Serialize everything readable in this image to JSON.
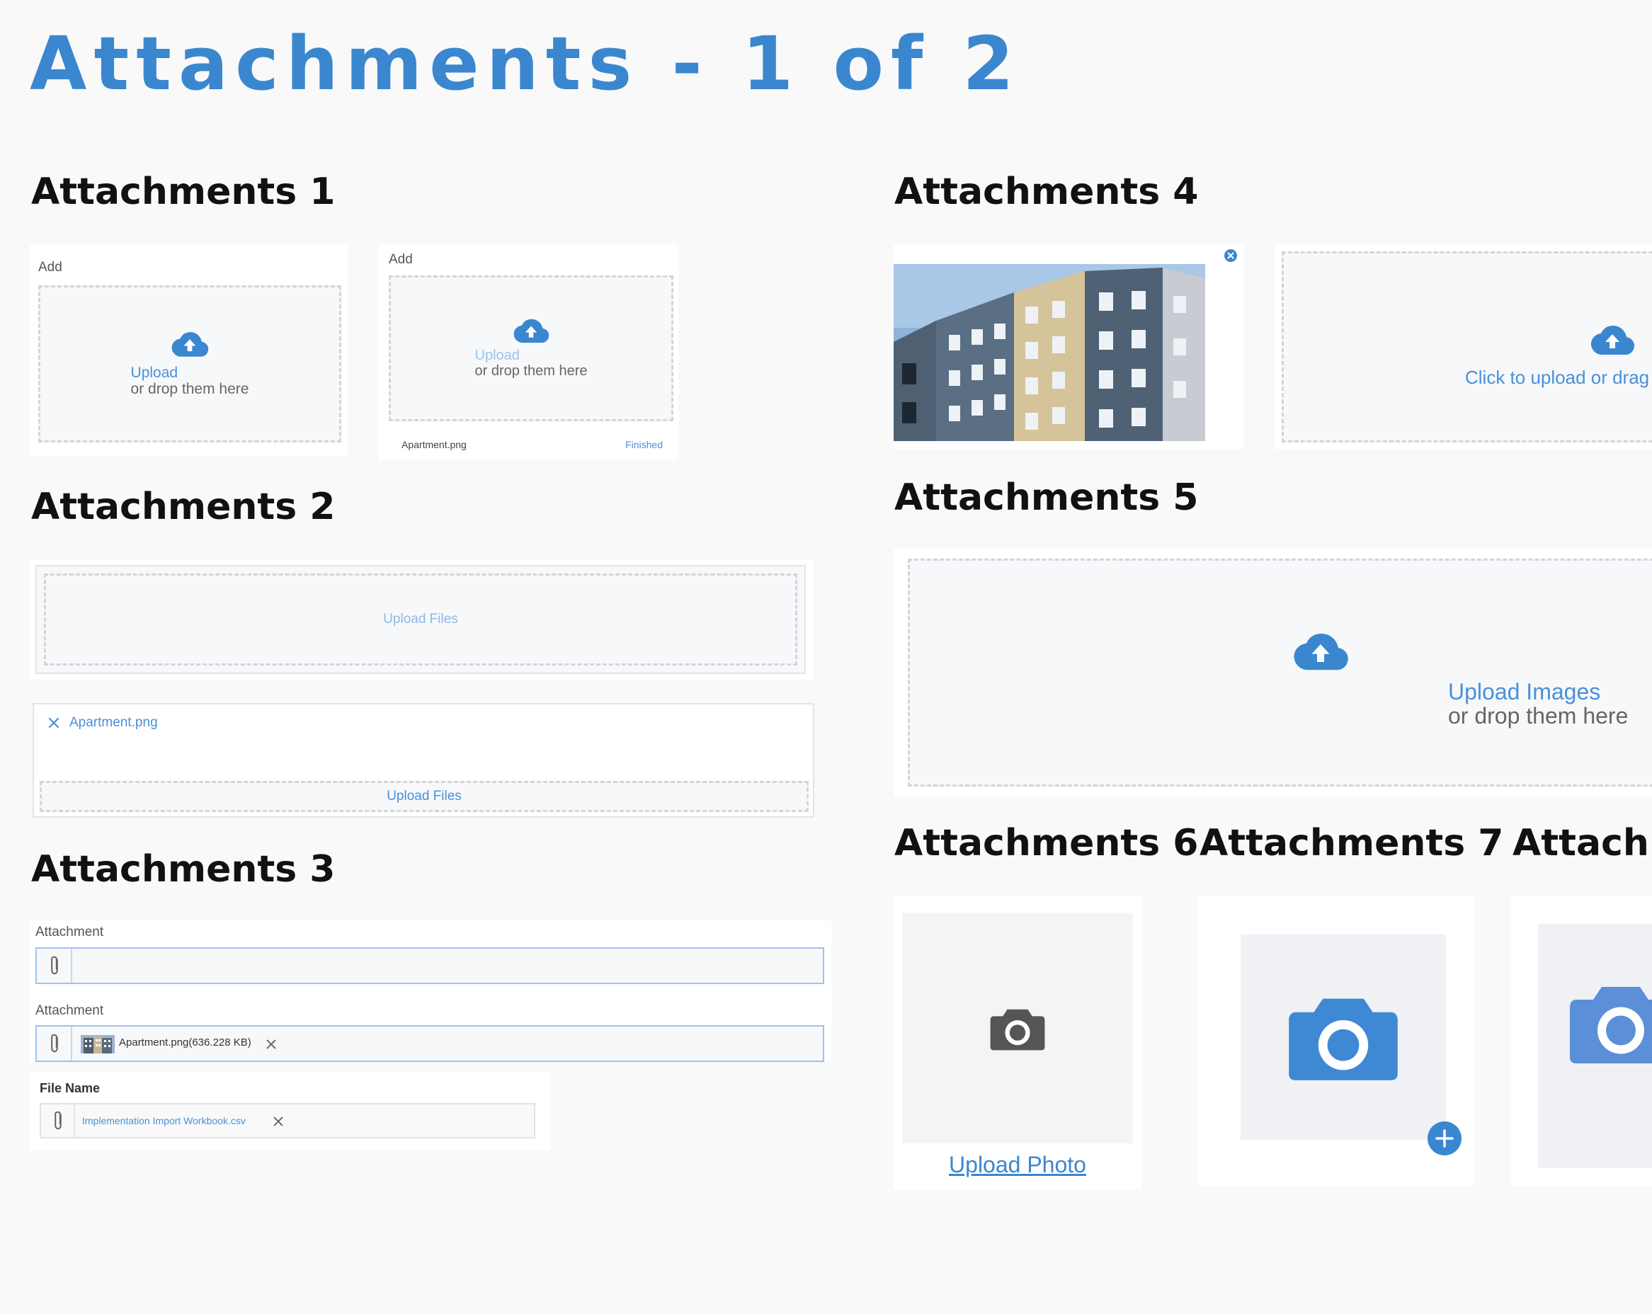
{
  "page": {
    "title": "Attachments - 1 of 2"
  },
  "colors": {
    "accent": "#3a87cf",
    "link": "#4a90d9",
    "dashed_border": "#d2d5da",
    "camera_blue": "#3f88d4"
  },
  "section1": {
    "heading": "Attachments 1",
    "widget_a": {
      "label": "Add",
      "upload_link": "Upload",
      "drop_text": "or drop them here",
      "icon": "cloud-upload-icon"
    },
    "widget_b": {
      "label": "Add",
      "upload_link": "Upload",
      "drop_text": "or drop them here",
      "file_name": "Apartment.png",
      "status": "Finished",
      "icon": "cloud-upload-icon"
    }
  },
  "section2": {
    "heading": "Attachments 2",
    "widget_a": {
      "upload_text": "Upload Files"
    },
    "widget_b": {
      "file_name": "Apartment.png",
      "upload_text": "Upload Files",
      "remove_icon": "close-icon"
    }
  },
  "section3": {
    "heading": "Attachments 3",
    "field_a": {
      "label": "Attachment",
      "value": "",
      "icon": "paperclip-icon"
    },
    "field_b": {
      "label": "Attachment",
      "file_text": "Apartment.png(636.228 KB)",
      "icon": "paperclip-icon"
    },
    "field_c": {
      "label": "File Name",
      "file_text": "Implementation Import Workbook.csv",
      "icon": "paperclip-icon"
    }
  },
  "section4": {
    "heading": "Attachments 4",
    "thumbnail": {
      "alt": "Apartment building photo",
      "remove_icon": "close-circle-icon"
    },
    "dropzone": {
      "text": "Click to upload or drag a",
      "icon": "cloud-upload-icon"
    }
  },
  "section5": {
    "heading": "Attachments 5",
    "dropzone": {
      "upload_link": "Upload Images",
      "drop_text": "or drop them here",
      "icon": "cloud-upload-icon"
    }
  },
  "section6": {
    "heading": "Attachments 6",
    "link": "Upload Photo",
    "icon": "camera-icon"
  },
  "section7": {
    "heading": "Attachments 7",
    "icon": "camera-icon",
    "add_icon": "plus-icon"
  },
  "section8": {
    "heading": "Attachn",
    "icon": "camera-icon"
  }
}
